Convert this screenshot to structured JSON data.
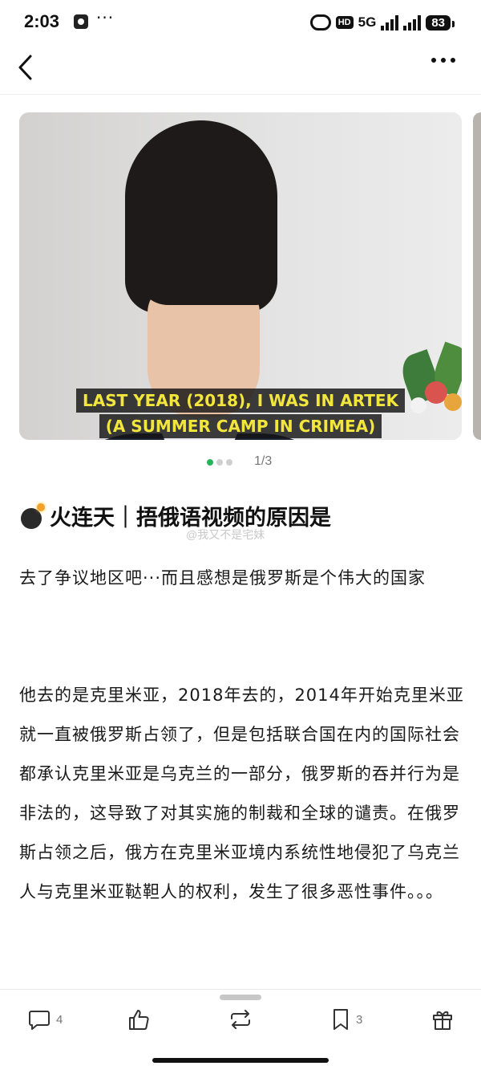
{
  "status_bar": {
    "time": "2:03",
    "more": "···",
    "hd": "HD",
    "network": "5G",
    "battery": "83"
  },
  "nav": {
    "back_icon": "chevron-left-icon",
    "more_icon": "more-horizontal-icon"
  },
  "media": {
    "caption_line1": "LAST YEAR (2018), I WAS IN ARTEK",
    "caption_line2": "(A SUMMER CAMP IN CRIMEA)",
    "page_indicator": "1/3",
    "dot_active_color": "#27b35b"
  },
  "post": {
    "title": "火连天｜捂俄语视频的原因是",
    "watermark": "@我又不是宅妹",
    "paragraph1": "去了争议地区吧···而且感想是俄罗斯是个伟大的国家",
    "paragraph2": "他去的是克里米亚，2018年去的，2014年开始克里米亚就一直被俄罗斯占领了，但是包括联合国在内的国际社会都承认克里米亚是乌克兰的一部分，俄罗斯的吞并行为是非法的，这导致了对其实施的制裁和全球的谴责。在俄罗斯占领之后，俄方在克里米亚境内系统性地侵犯了乌克兰人与克里米亚鞑靼人的权利，发生了很多恶性事件。。。"
  },
  "actions": {
    "comment_count": "4",
    "favorite_count": "3"
  }
}
